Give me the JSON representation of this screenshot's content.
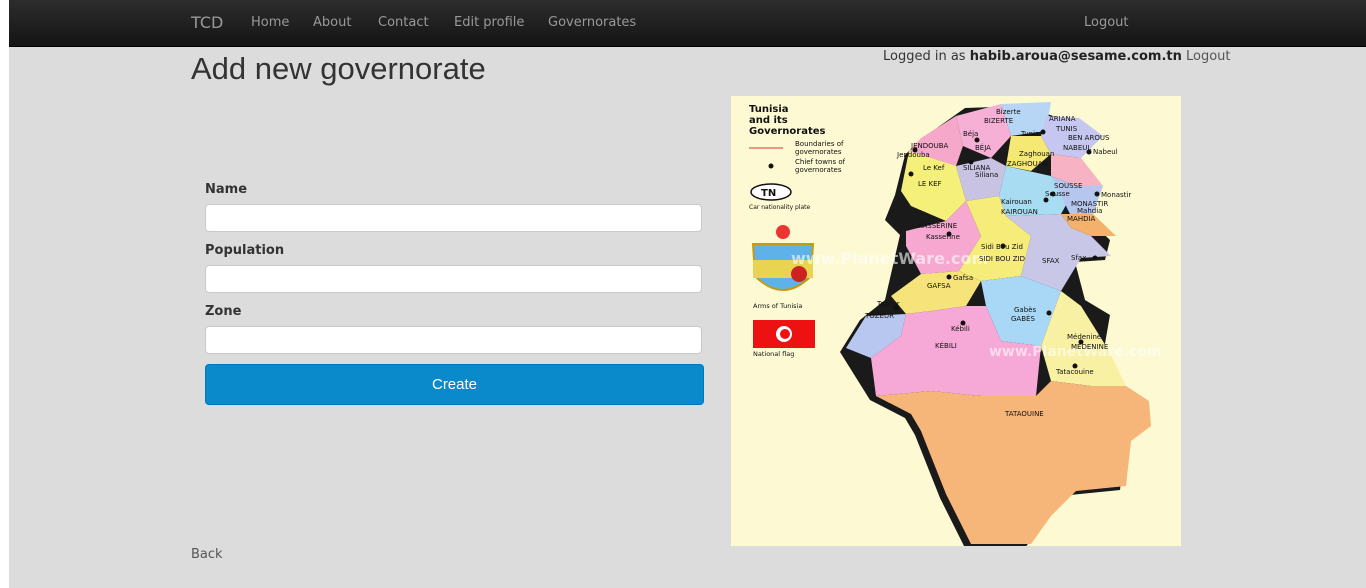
{
  "navbar": {
    "brand": "TCD",
    "items": [
      "Home",
      "About",
      "Contact",
      "Edit profile",
      "Governorates"
    ],
    "logout": "Logout"
  },
  "login": {
    "prefix": "Logged in as",
    "user": "habib.aroua@sesame.com.tn",
    "logout": "Logout"
  },
  "page": {
    "title": "Add new governorate"
  },
  "form": {
    "name_label": "Name",
    "name_value": "",
    "population_label": "Population",
    "population_value": "",
    "zone_label": "Zone",
    "zone_value": "",
    "submit_label": "Create"
  },
  "back_link": "Back",
  "map": {
    "title_lines": [
      "Tunisia",
      "and its",
      "Governorates"
    ],
    "legend": {
      "boundaries": [
        "Boundaries of",
        "governorates"
      ],
      "chief_towns": [
        "Chief towns of",
        "governorates"
      ],
      "plate": "TN",
      "plate_label": "Car nationality plate",
      "arms_label": "Arms of Tunisia",
      "flag_label": "National flag"
    },
    "watermark": "www.PlanetWare.com",
    "labels": [
      "Bizerte",
      "BIZERTE",
      "ARIANA",
      "TUNIS",
      "Tunis",
      "BEN AROUS",
      "Béja",
      "BÉJA",
      "NABEUL",
      "Nabeul",
      "JENDOUBA",
      "Jendouba",
      "Zaghouan",
      "ZAGHOUAN",
      "SILIANA",
      "Siliana",
      "Le Kef",
      "LE KEF",
      "SOUSSE",
      "Sousse",
      "Monastir",
      "MONASTIR",
      "Mahdia",
      "MAHDIA",
      "Kairouan",
      "KAIROUAN",
      "KASSERINE",
      "Kasserine",
      "Sidi Bou Zid",
      "SIDI BOU ZID",
      "SFAX",
      "Sfax",
      "Gafsa",
      "GAFSA",
      "Tozeur",
      "TOZEUR",
      "Kébili",
      "KÉBILI",
      "Gabès",
      "GABÈS",
      "Médenine",
      "MÉDENINE",
      "Tatacouine",
      "TATAOUINE"
    ]
  },
  "colors": {
    "navbar": "#1c1c1c",
    "page_bg": "#dcdcdc",
    "primary_button": "#0a8acb",
    "map_bg": "#fdf9d2"
  }
}
